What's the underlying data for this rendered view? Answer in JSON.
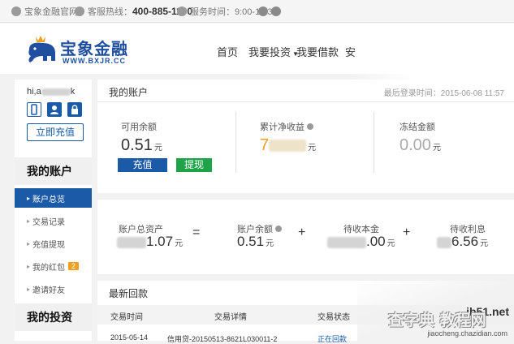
{
  "topbar": {
    "site_label": "宝象金融官网",
    "hotline_label": "客服热线：",
    "hotline_number": "400-885-1100",
    "service_hours": "服务时间：9:00-17:30"
  },
  "header": {
    "logo_name": "宝象金融",
    "logo_url": "WWW.BXJR.CC",
    "nav": [
      "首页",
      "我要投资",
      "我要借款",
      "安"
    ]
  },
  "sidebar": {
    "greeting": "hi,a",
    "greeting_suffix": "k",
    "recharge_button": "立即充值",
    "section_account": "我的账户",
    "menu": [
      {
        "label": "账户总览"
      },
      {
        "label": "交易记录"
      },
      {
        "label": "充值提现"
      },
      {
        "label": "我的红包",
        "badge": "2"
      },
      {
        "label": "邀请好友"
      }
    ],
    "section_invest": "我的投资"
  },
  "account": {
    "title": "我的账户",
    "last_login": "最后登录时间：2015-06-08 11:57",
    "available_label": "可用余额",
    "available_value": "0.51",
    "unit": "元",
    "recharge": "充值",
    "withdraw": "提现",
    "net_income_label": "累计净收益",
    "net_income_visible": "7",
    "frozen_label": "冻结金额",
    "frozen_value": "0.00"
  },
  "summary": {
    "total_assets_label": "账户总资产",
    "total_assets_visible": "1.07",
    "balance_label": "账户余额",
    "balance_value": "0.51",
    "principal_label": "待收本金",
    "principal_visible": ".00",
    "interest_label": "待收利息",
    "interest_visible": "6.56",
    "unit": "元",
    "eq": "=",
    "plus": "+"
  },
  "recent": {
    "title": "最新回款",
    "columns": [
      "交易时间",
      "交易详情",
      "交易状态"
    ],
    "rows": [
      {
        "date": "2015-05-14",
        "detail": "信用贷-20150513-8621L030011-2",
        "status": "正在回款"
      }
    ]
  },
  "watermark": {
    "site": "jb51.net",
    "cn": "查字典 教程网",
    "url": "jiaocheng.chazidian.com"
  },
  "colors": {
    "brand_blue": "#1a5aa6",
    "green": "#1fa349",
    "orange": "#f0a020"
  }
}
